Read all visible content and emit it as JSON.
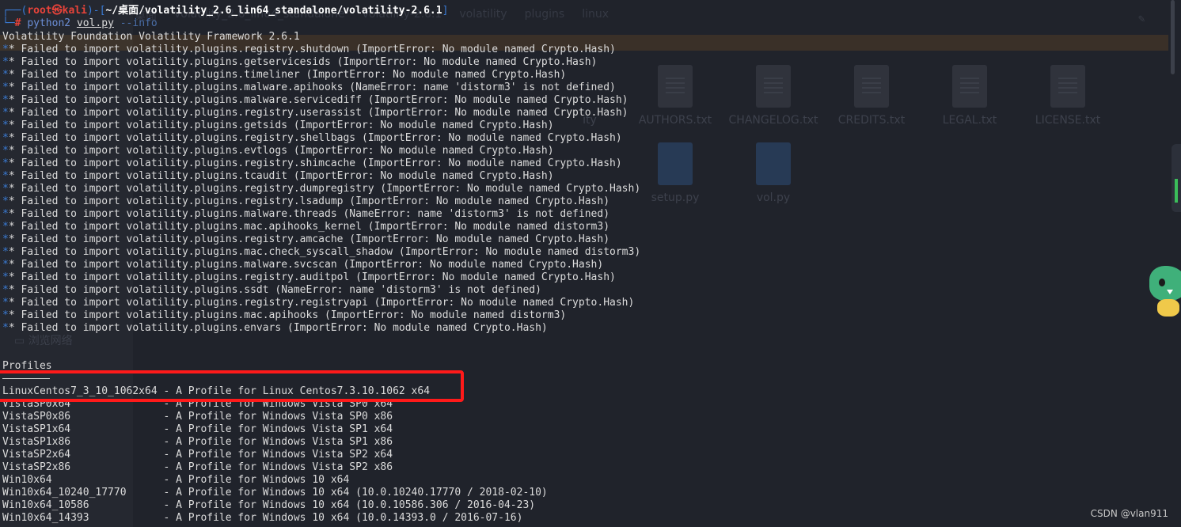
{
  "background": {
    "sidebar_item": "浏览网络",
    "path_parts": [
      "桌面",
      "volatility_2.6_lin64_standalone",
      "volatility-2.6.1",
      "volatility",
      "plugins",
      "linux"
    ],
    "files": [
      "AUTHORS.txt",
      "CHANGELOG.txt",
      "CREDITS.txt",
      "LEGAL.txt",
      "LICENSE.txt",
      "setup.py",
      "vol.py"
    ],
    "partial_file": "ity"
  },
  "prompt": {
    "corner_top": "┌──(",
    "user_host": "root㉿kali",
    "sep": ")-[",
    "path": "~/桌面/volatility_2.6_lin64_standalone/volatility-2.6.1",
    "close": "]",
    "corner_bottom": "└─",
    "hash": "#",
    "command": "python2",
    "script": "vol.py",
    "option": "--info"
  },
  "output": {
    "banner": "Volatility Foundation Volatility Framework 2.6.1",
    "star_prefix": "*",
    "errors": [
      "* Failed to import volatility.plugins.registry.shutdown (ImportError: No module named Crypto.Hash)",
      "* Failed to import volatility.plugins.getservicesids (ImportError: No module named Crypto.Hash)",
      "* Failed to import volatility.plugins.timeliner (ImportError: No module named Crypto.Hash)",
      "* Failed to import volatility.plugins.malware.apihooks (NameError: name 'distorm3' is not defined)",
      "* Failed to import volatility.plugins.malware.servicediff (ImportError: No module named Crypto.Hash)",
      "* Failed to import volatility.plugins.registry.userassist (ImportError: No module named Crypto.Hash)",
      "* Failed to import volatility.plugins.getsids (ImportError: No module named Crypto.Hash)",
      "* Failed to import volatility.plugins.registry.shellbags (ImportError: No module named Crypto.Hash)",
      "* Failed to import volatility.plugins.evtlogs (ImportError: No module named Crypto.Hash)",
      "* Failed to import volatility.plugins.registry.shimcache (ImportError: No module named Crypto.Hash)",
      "* Failed to import volatility.plugins.tcaudit (ImportError: No module named Crypto.Hash)",
      "* Failed to import volatility.plugins.registry.dumpregistry (ImportError: No module named Crypto.Hash)",
      "* Failed to import volatility.plugins.registry.lsadump (ImportError: No module named Crypto.Hash)",
      "* Failed to import volatility.plugins.malware.threads (NameError: name 'distorm3' is not defined)",
      "* Failed to import volatility.plugins.mac.apihooks_kernel (ImportError: No module named distorm3)",
      "* Failed to import volatility.plugins.registry.amcache (ImportError: No module named Crypto.Hash)",
      "* Failed to import volatility.plugins.mac.check_syscall_shadow (ImportError: No module named distorm3)",
      "* Failed to import volatility.plugins.malware.svcscan (ImportError: No module named Crypto.Hash)",
      "* Failed to import volatility.plugins.registry.auditpol (ImportError: No module named Crypto.Hash)",
      "* Failed to import volatility.plugins.ssdt (NameError: name 'distorm3' is not defined)",
      "* Failed to import volatility.plugins.registry.registryapi (ImportError: No module named Crypto.Hash)",
      "* Failed to import volatility.plugins.mac.apihooks (ImportError: No module named distorm3)",
      "* Failed to import volatility.plugins.envars (ImportError: No module named Crypto.Hash)"
    ],
    "profiles_header": "Profiles",
    "profiles": [
      "LinuxCentos7_3_10_1062x64 - A Profile for Linux Centos7.3.10.1062 x64",
      "VistaSP0x64               - A Profile for Windows Vista SP0 x64",
      "VistaSP0x86               - A Profile for Windows Vista SP0 x86",
      "VistaSP1x64               - A Profile for Windows Vista SP1 x64",
      "VistaSP1x86               - A Profile for Windows Vista SP1 x86",
      "VistaSP2x64               - A Profile for Windows Vista SP2 x64",
      "VistaSP2x86               - A Profile for Windows Vista SP2 x86",
      "Win10x64                  - A Profile for Windows 10 x64",
      "Win10x64_10240_17770      - A Profile for Windows 10 x64 (10.0.10240.17770 / 2018-02-10)",
      "Win10x64_10586            - A Profile for Windows 10 x64 (10.0.10586.306 / 2016-04-23)",
      "Win10x64_14393            - A Profile for Windows 10 x64 (10.0.14393.0 / 2016-07-16)"
    ]
  },
  "watermark": "CSDN @vlan911",
  "colors": {
    "terminal_bg": "#20232b",
    "prompt_blue": "#3a7bd5",
    "prompt_red": "#e8433a",
    "highlight_box": "#ff1a1a"
  }
}
